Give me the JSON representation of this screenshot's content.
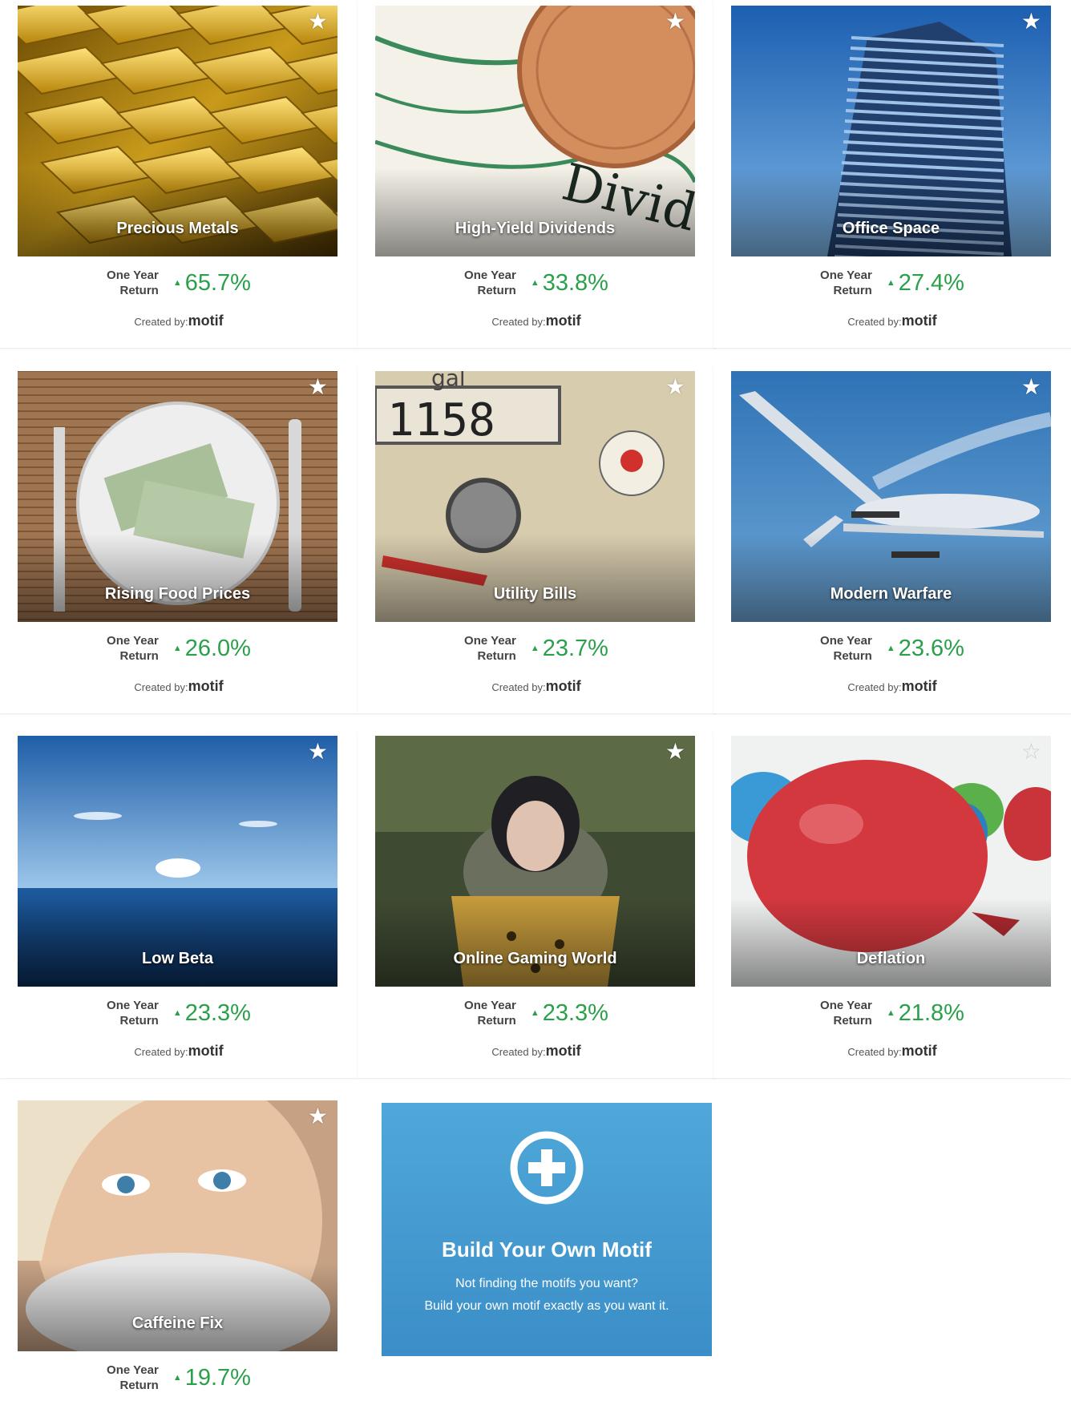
{
  "return_label_line1": "One Year",
  "return_label_line2": "Return",
  "created_by_label": "Created by:",
  "created_by_brand": "motif",
  "motifs": [
    {
      "title": "Precious Metals",
      "return": "65.7%",
      "starred": true,
      "image": "gold-bars"
    },
    {
      "title": "High-Yield Dividends",
      "return": "33.8%",
      "starred": true,
      "image": "dollar-coin"
    },
    {
      "title": "Office Space",
      "return": "27.4%",
      "starred": true,
      "image": "office-tower"
    },
    {
      "title": "Rising Food Prices",
      "return": "26.0%",
      "starred": true,
      "image": "plate-of-money"
    },
    {
      "title": "Utility Bills",
      "return": "23.7%",
      "starred": true,
      "image": "meter-dial"
    },
    {
      "title": "Modern Warfare",
      "return": "23.6%",
      "starred": true,
      "image": "drone"
    },
    {
      "title": "Low Beta",
      "return": "23.3%",
      "starred": true,
      "image": "calm-sea"
    },
    {
      "title": "Online Gaming World",
      "return": "23.3%",
      "starred": true,
      "image": "game-character"
    },
    {
      "title": "Deflation",
      "return": "21.8%",
      "starred": false,
      "image": "balloons"
    },
    {
      "title": "Caffeine Fix",
      "return": "19.7%",
      "starred": true,
      "image": "woman-with-cup"
    }
  ],
  "build_card": {
    "icon": "plus-circle-icon",
    "title": "Build Your Own Motif",
    "line1": "Not finding the motifs you want?",
    "line2": "Build your own motif exactly as you want it."
  },
  "colors": {
    "return_green": "#2aa04a",
    "build_blue": "#3b8ec7"
  }
}
